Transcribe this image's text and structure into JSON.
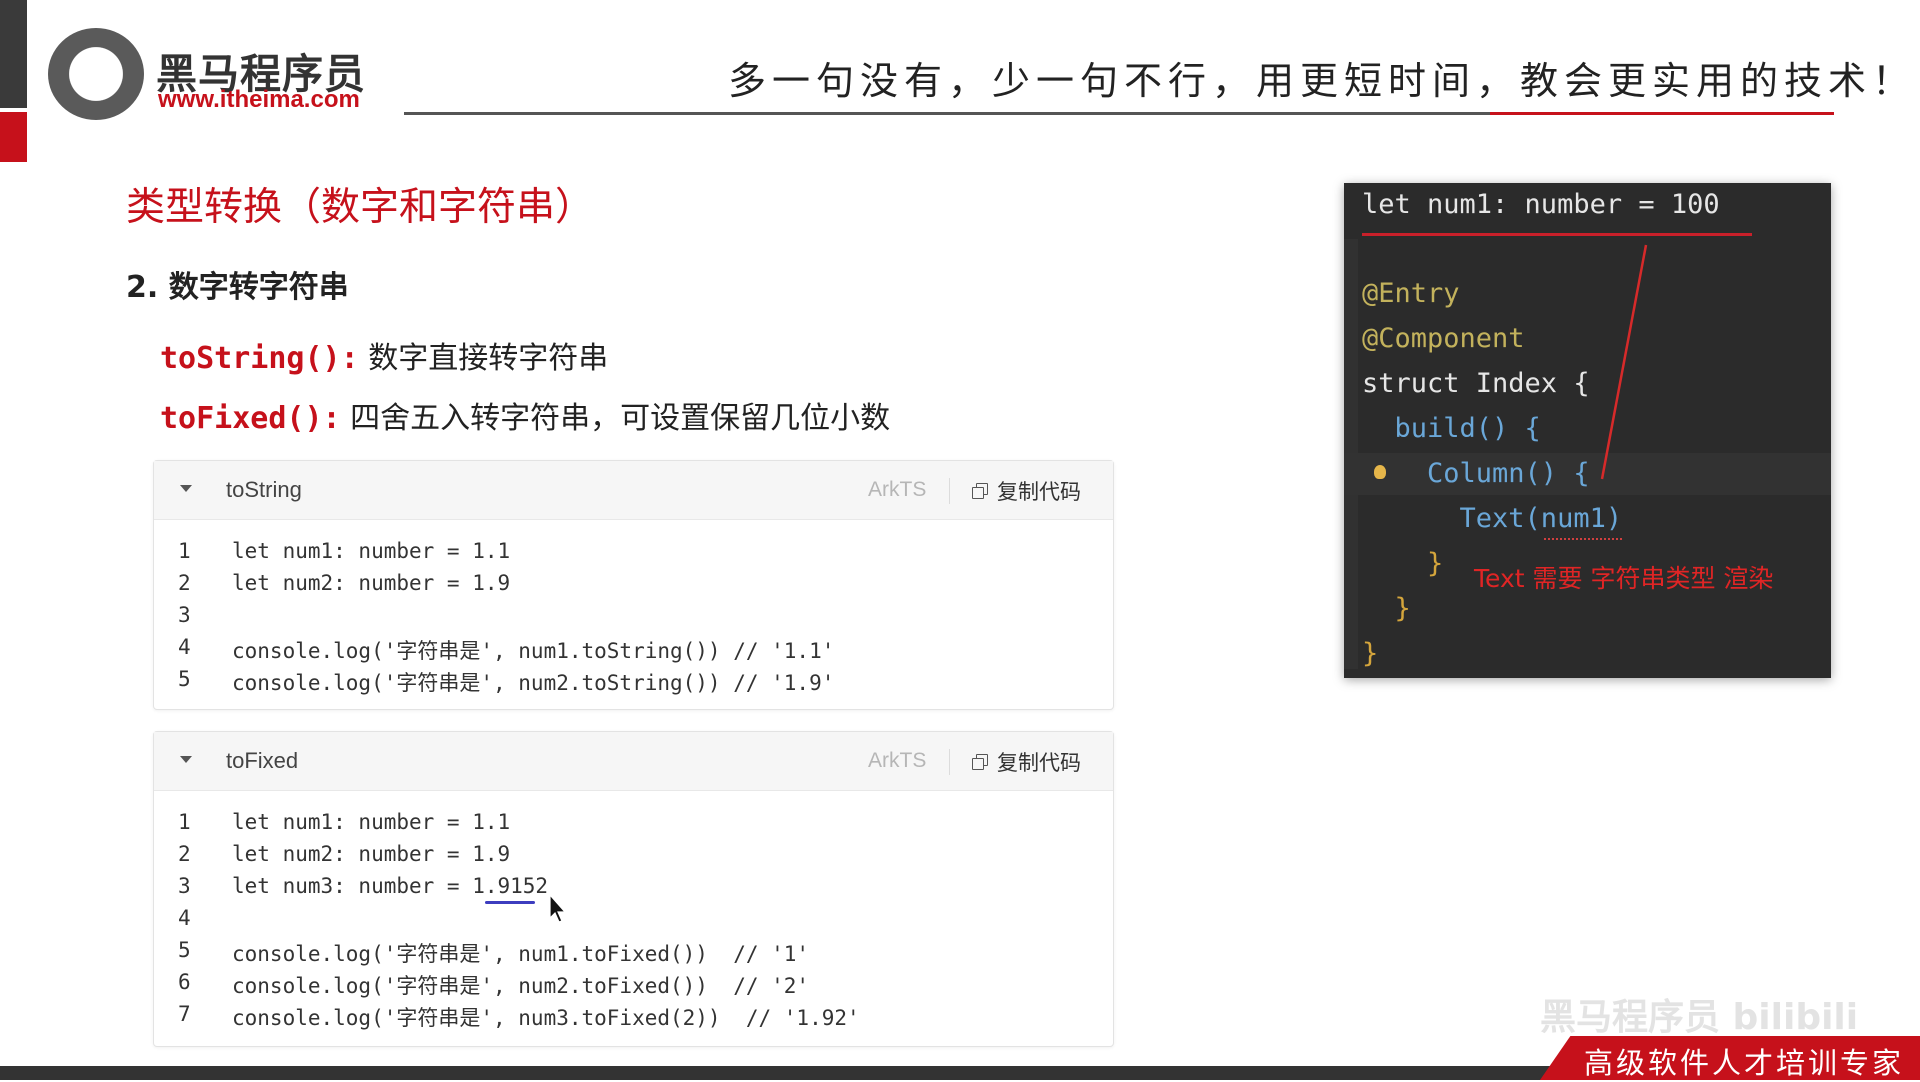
{
  "brand": {
    "name": "黑马程序员",
    "url": "www.itheima.com",
    "slogan": "多一句没有，少一句不行，用更短时间，教会更实用的技术！"
  },
  "slide": {
    "title": "类型转换（数字和字符串）",
    "subtitle": "2. 数字转字符串",
    "items": [
      {
        "fn": "toString():",
        "text": " 数字直接转字符串"
      },
      {
        "fn": "toFixed():",
        "text": " 四舍五入转字符串，可设置保留几位小数"
      }
    ]
  },
  "cards": [
    {
      "name": "toString",
      "lang": "ArkTS",
      "copy_label": "复制代码",
      "lines": [
        {
          "n": "1",
          "code": "let num1: number = 1.1"
        },
        {
          "n": "2",
          "code": "let num2: number = 1.9"
        },
        {
          "n": "3",
          "code": ""
        },
        {
          "n": "4",
          "code": "console.log('字符串是', num1.toString()) // '1.1'"
        },
        {
          "n": "5",
          "code": "console.log('字符串是', num2.toString()) // '1.9'"
        }
      ]
    },
    {
      "name": "toFixed",
      "lang": "ArkTS",
      "copy_label": "复制代码",
      "lines": [
        {
          "n": "1",
          "code": "let num1: number = 1.1"
        },
        {
          "n": "2",
          "code": "let num2: number = 1.9"
        },
        {
          "n": "3",
          "code": "let num3: number = 1.9152"
        },
        {
          "n": "4",
          "code": ""
        },
        {
          "n": "5",
          "code": "console.log('字符串是', num1.toFixed())  // '1'"
        },
        {
          "n": "6",
          "code": "console.log('字符串是', num2.toFixed())  // '2'"
        },
        {
          "n": "7",
          "code": "console.log('字符串是', num3.toFixed(2))  // '1.92'"
        }
      ]
    }
  ],
  "editor": {
    "lines": [
      "let num1: number = 100",
      "",
      "@Entry",
      "@Component",
      "struct Index {",
      "  build() {",
      "    Column() {",
      "      Text(num1)",
      "    }",
      "  }",
      "}"
    ],
    "note": "Text 需要 字符串类型 渲染"
  },
  "footer": {
    "badge": "高级软件人才培训专家",
    "watermark": "黑马程序员 bilibili"
  },
  "colors": {
    "accent": "#c6111b",
    "editor_bg": "#2b2b2b"
  }
}
